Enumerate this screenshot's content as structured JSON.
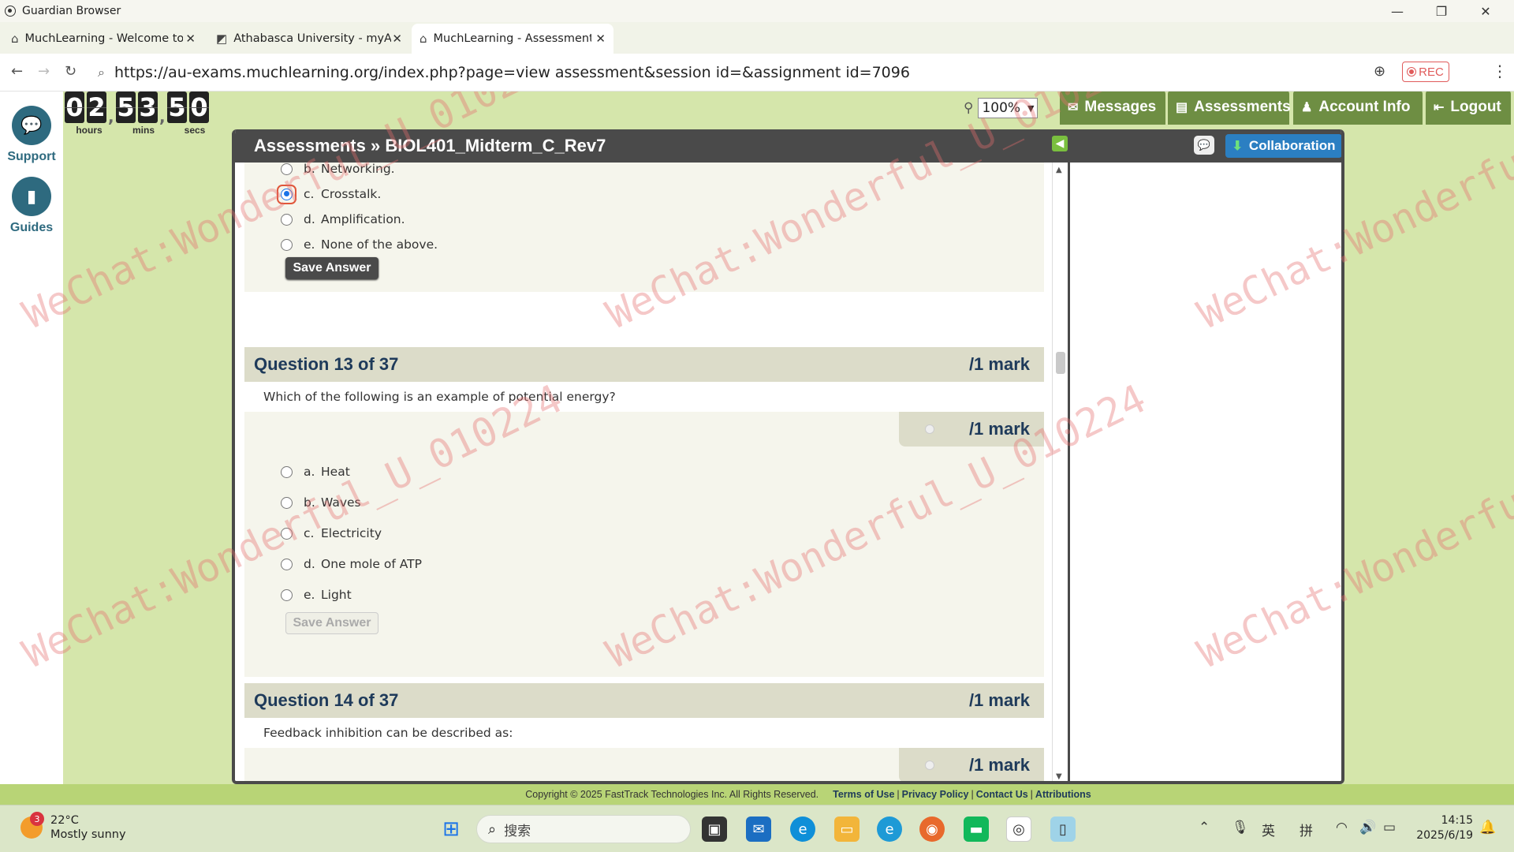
{
  "window": {
    "title": "Guardian Browser",
    "controls": [
      "—",
      "❐",
      "✕"
    ]
  },
  "tabs": [
    {
      "label": "MuchLearning - Welcome to I",
      "active": false
    },
    {
      "label": "Athabasca University - myAU",
      "active": false
    },
    {
      "label": "MuchLearning - Assessments",
      "active": true
    }
  ],
  "address": {
    "url": "https://au-exams.muchlearning.org/index.php?page=view assessment&session id=&assignment id=7096",
    "rec_label": "REC"
  },
  "rail": {
    "support_label": "Support",
    "guides_label": "Guides"
  },
  "timer": {
    "digits": [
      "0",
      "2",
      "5",
      "3",
      "5",
      "0"
    ],
    "hours_label": "hours",
    "mins_label": "mins",
    "secs_label": "secs"
  },
  "zoom": {
    "value": "100%"
  },
  "nav": {
    "messages": "Messages",
    "assessments": "Assessments",
    "account": "Account Info",
    "logout": "Logout"
  },
  "panel": {
    "title": "Assessments » BIOL401_Midterm_C_Rev7",
    "collab_label": "Collaboration"
  },
  "prev_question": {
    "options": [
      {
        "letter": "b.",
        "text": "Networking.",
        "checked": false
      },
      {
        "letter": "c.",
        "text": "Crosstalk.",
        "checked": true
      },
      {
        "letter": "d.",
        "text": "Amplification.",
        "checked": false
      },
      {
        "letter": "e.",
        "text": "None of the above.",
        "checked": false
      }
    ],
    "save_label": "Save Answer"
  },
  "q13": {
    "number": "Question 13 of 37",
    "mark": "/1 mark",
    "text": "Which of the following is an example of potential energy?",
    "score_mark": "/1 mark",
    "options": [
      {
        "letter": "a.",
        "text": "Heat"
      },
      {
        "letter": "b.",
        "text": "Waves"
      },
      {
        "letter": "c.",
        "text": "Electricity"
      },
      {
        "letter": "d.",
        "text": "One mole of ATP"
      },
      {
        "letter": "e.",
        "text": "Light"
      }
    ],
    "save_label": "Save Answer"
  },
  "q14": {
    "number": "Question 14 of 37",
    "mark": "/1 mark",
    "text": "Feedback inhibition can be described as:",
    "score_mark": "/1 mark"
  },
  "footer": {
    "copyright": "Copyright © 2025 FastTrack Technologies Inc. All Rights Reserved.",
    "terms": "Terms of Use",
    "privacy": "Privacy Policy",
    "contact": "Contact Us",
    "attributions": "Attributions"
  },
  "taskbar": {
    "weather_badge": "3",
    "temperature": "22°C",
    "condition": "Mostly sunny",
    "search_placeholder": "搜索",
    "ime_lang": "英",
    "ime_mode": "拼",
    "time": "14:15",
    "date": "2025/6/19"
  },
  "watermark": "WeChat:Wonderful_U_010224",
  "colors": {
    "page_bg": "#d5e6ab",
    "nav_green": "#6e8e43",
    "panel_dark": "#4a4a4a",
    "collab_blue": "#2b7fc2",
    "heading_navy": "#1e3a5a"
  }
}
